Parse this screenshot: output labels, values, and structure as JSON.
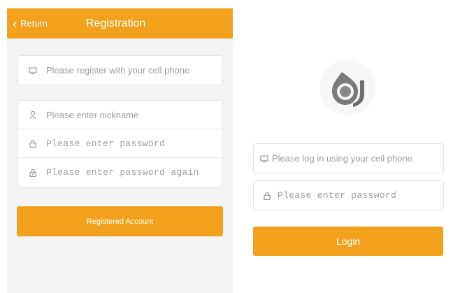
{
  "registration": {
    "header": {
      "back_label": "Return",
      "title": "Registration"
    },
    "phone_placeholder": "Please register with your cell phone",
    "nickname_placeholder": "Please enter nickname",
    "password_placeholder": "Please enter password",
    "confirm_password_placeholder": "Please enter password again",
    "submit_label": "Registered Account"
  },
  "login": {
    "phone_placeholder": "Please log in using your cell phone",
    "password_placeholder": "Please enter password",
    "submit_label": "Login"
  },
  "colors": {
    "accent": "#f1a11b",
    "panel_bg": "#f4f4f4",
    "logo_gray": "#6e6e6e"
  },
  "icons": [
    "chevron-left-icon",
    "phone-icon",
    "user-icon",
    "lock-icon",
    "lock-check-icon",
    "app-logo"
  ]
}
